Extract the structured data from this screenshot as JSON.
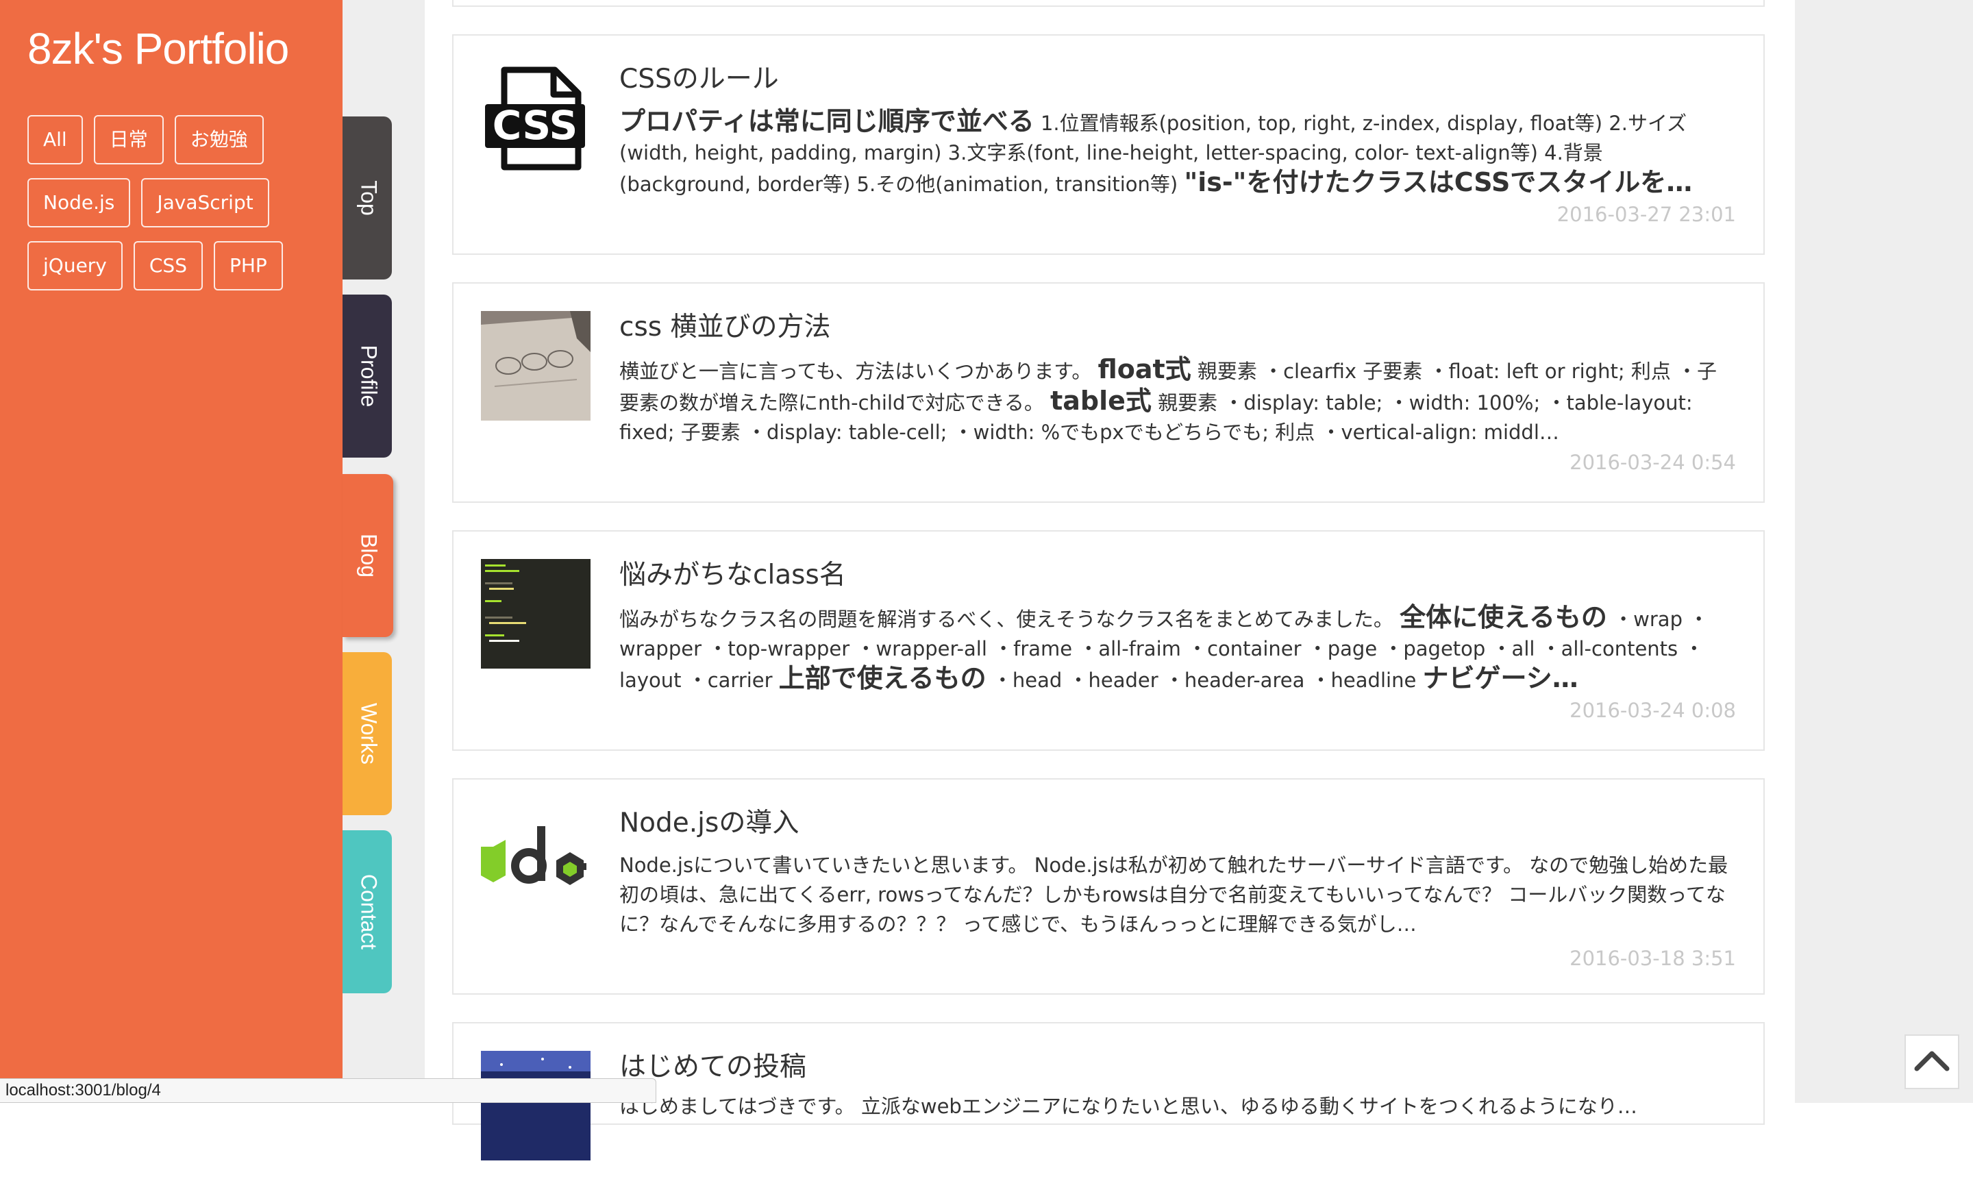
{
  "sidebar": {
    "site_title": "8zk's Portfolio",
    "tags": [
      "All",
      "日常",
      "お勉強",
      "Node.js",
      "JavaScript",
      "jQuery",
      "CSS",
      "PHP"
    ]
  },
  "nav": {
    "tabs": [
      {
        "label": "Top",
        "color": "#4a4646"
      },
      {
        "label": "Profile",
        "color": "#353042"
      },
      {
        "label": "Blog",
        "color": "#ef6c43",
        "active": true
      },
      {
        "label": "Works",
        "color": "#f8ae3b"
      },
      {
        "label": "Contact",
        "color": "#4fc6c0"
      }
    ]
  },
  "posts": [
    {
      "title": "CSSのルール",
      "thumb": "css-file-icon",
      "date": "2016-03-27 23:01",
      "segments": [
        {
          "t": "プロパティは常に同じ順序で並べる",
          "b": true
        },
        {
          "t": " 1.位置情報系(position, top, right, z-index, display, float等) 2.サイズ(width, height, padding, margin) 3.文字系(font, line-height, letter-spacing, color- text-align等) 4.背景(background, border等) 5.その他(animation, transition等) "
        },
        {
          "t": "\"is-\"を付けたクラスはCSSでスタイルを…",
          "b": true
        }
      ]
    },
    {
      "title": "css 横並びの方法",
      "thumb": "sketch-photo",
      "date": "2016-03-24 0:54",
      "segments": [
        {
          "t": "横並びと一言に言っても、方法はいくつかあります。 "
        },
        {
          "t": "float式",
          "b": true
        },
        {
          "t": " 親要素 ・clearfix 子要素 ・float: left or right; 利点 ・子要素の数が増えた際にnth-childで対応できる。 "
        },
        {
          "t": "table式",
          "b": true
        },
        {
          "t": " 親要素 ・display: table; ・width: 100%; ・table-layout: fixed; 子要素 ・display: table-cell; ・width: %でもpxでもどちらでも; 利点 ・vertical-align: middl…"
        }
      ]
    },
    {
      "title": "悩みがちなclass名",
      "thumb": "code-editor",
      "date": "2016-03-24 0:08",
      "segments": [
        {
          "t": "悩みがちなクラス名の問題を解消するべく、使えそうなクラス名をまとめてみました。 "
        },
        {
          "t": "全体に使えるもの",
          "b": true
        },
        {
          "t": " ・wrap ・wrapper ・top-wrapper ・wrapper-all ・frame ・all-fraim ・container ・page ・pagetop ・all ・all-contents ・layout ・carrier "
        },
        {
          "t": "上部で使えるもの",
          "b": true
        },
        {
          "t": " ・head ・header ・header-area ・headline "
        },
        {
          "t": "ナビゲーシ…",
          "b": true
        }
      ]
    },
    {
      "title": "Node.jsの導入",
      "thumb": "node-logo",
      "date": "2016-03-18 3:51",
      "segments": [
        {
          "t": "Node.jsについて書いていきたいと思います。 Node.jsは私が初めて触れたサーバーサイド言語です。 なので勉強し始めた最初の頃は、急に出てくるerr, rowsってなんだ？しかもrowsは自分で名前変えてもいいってなんで？ コールバック関数ってなに？なんでそんなに多用するの？？？ って感じで、もうほんっっとに理解できる気がし…"
        }
      ]
    },
    {
      "title": "はじめての投稿",
      "thumb": "space-photo",
      "date": "",
      "segments": [
        {
          "t": "はじめましてはづきです。 立派なwebエンジニアになりたいと思い、ゆるゆる動くサイトをつくれるようになり…"
        }
      ]
    }
  ],
  "status_bar": {
    "url": "localhost:3001/blog/4"
  },
  "page_top": {
    "icon": "chevron-up-icon"
  }
}
